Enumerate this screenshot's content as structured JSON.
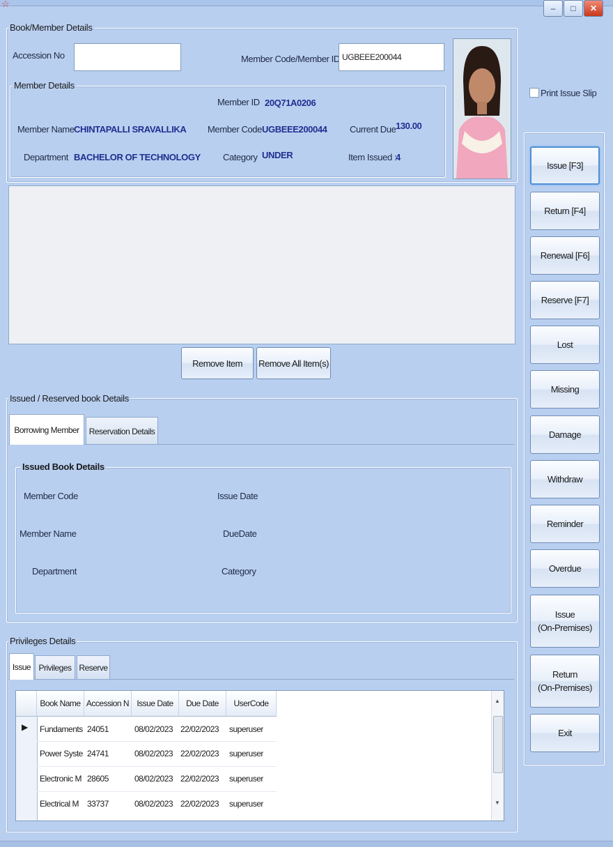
{
  "window": {
    "min_label": "–",
    "max_label": "□",
    "close_label": "✕",
    "app_icon": "star-icon"
  },
  "book_member": {
    "group_title": "Book/Member Details",
    "accession_label": "Accession No",
    "accession_value": "",
    "member_code_id_label": "Member Code/Member ID",
    "member_code_id_value": "UGBEEE200044"
  },
  "member_details": {
    "group_title": "Member Details",
    "member_id_label": "Member ID",
    "member_id_value": "20Q71A0206",
    "member_name_label": "Member Name",
    "member_name_value": "CHINTAPALLI  SRAVALLIKA",
    "member_code_label": "Member Code",
    "member_code_value": "UGBEEE200044",
    "current_due_label": "Current Due",
    "current_due_value": "130.00",
    "department_label": "Department",
    "department_value": "BACHELOR OF TECHNOLOGY",
    "category_label": "Category",
    "category_value": "UNDER",
    "item_issued_label": "Item Issued :",
    "item_issued_value": "4"
  },
  "print_issue_slip": {
    "label": "Print Issue Slip",
    "checked": false
  },
  "item_buttons": {
    "remove_item": "Remove Item",
    "remove_all": "Remove All Item(s)"
  },
  "actions": [
    {
      "label": "Issue [F3]"
    },
    {
      "label": "Return [F4]"
    },
    {
      "label": "Renewal [F6]"
    },
    {
      "label": "Reserve [F7]"
    },
    {
      "label": "Lost"
    },
    {
      "label": "Missing"
    },
    {
      "label": "Damage"
    },
    {
      "label": "Withdraw"
    },
    {
      "label": "Reminder"
    },
    {
      "label": "Overdue"
    },
    {
      "label": "Issue\n(On-Premises)"
    },
    {
      "label": "Return\n(On-Premises)"
    },
    {
      "label": "Exit"
    }
  ],
  "issued_reserved": {
    "group_title": "Issued / Reserved book Details",
    "tabs": [
      "Borrowing Member",
      "Reservation Details"
    ],
    "inner_title": "Issued Book Details",
    "member_code_label": "Member Code",
    "member_name_label": "Member Name",
    "department_label": "Department",
    "issue_date_label": "Issue Date",
    "due_date_label": "DueDate",
    "category_label": "Category"
  },
  "privileges": {
    "group_title": "Privileges Details",
    "tabs": [
      "Issue",
      "Privileges",
      "Reserve"
    ],
    "columns": [
      "Book Name",
      "Accession N",
      "Issue Date",
      "Due Date",
      "UserCode"
    ],
    "rows": [
      [
        "Fundaments",
        "24051",
        "08/02/2023",
        "22/02/2023",
        "superuser"
      ],
      [
        "Power Syste",
        "24741",
        "08/02/2023",
        "22/02/2023",
        "superuser"
      ],
      [
        "Electronic M",
        "28605",
        "08/02/2023",
        "22/02/2023",
        "superuser"
      ],
      [
        "Electrical M",
        "33737",
        "08/02/2023",
        "22/02/2023",
        "superuser"
      ]
    ]
  }
}
